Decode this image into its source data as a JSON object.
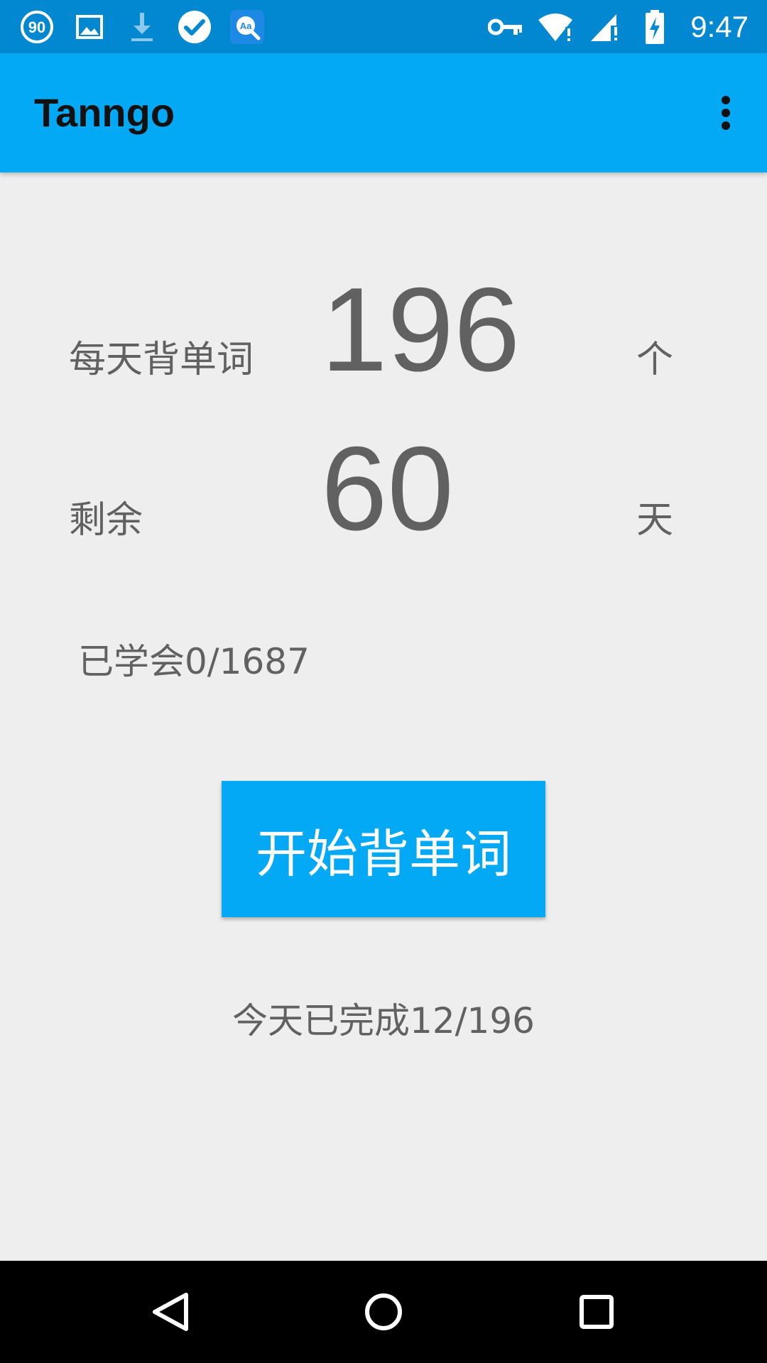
{
  "status_bar": {
    "time": "9:47",
    "left_icons": [
      "speed-90-icon",
      "image-icon",
      "download-icon",
      "check-circle-icon",
      "dictionary-icon"
    ],
    "right_icons": [
      "vpn-key-icon",
      "wifi-icon",
      "cell-signal-icon",
      "battery-charging-icon"
    ],
    "badge_number": "90",
    "dict_badge": "Aa"
  },
  "app_bar": {
    "title": "Tanngo",
    "overflow_icon": "more-vert-icon"
  },
  "main": {
    "daily_words_label": "每天背单词",
    "daily_words_value": "196",
    "daily_words_unit": "个",
    "remaining_label": "剩余",
    "remaining_value": "60",
    "remaining_unit": "天",
    "learned_text": "已学会0/1687",
    "start_button_label": "开始背单词",
    "today_progress_text": "今天已完成12/196"
  },
  "nav_bar": {
    "buttons": [
      "back-icon",
      "home-icon",
      "recents-icon"
    ]
  },
  "colors": {
    "status_bar": "#0288d1",
    "app_bar": "#03a9f4",
    "accent": "#03a9f4",
    "background": "#eeeeee",
    "text": "#616161"
  }
}
